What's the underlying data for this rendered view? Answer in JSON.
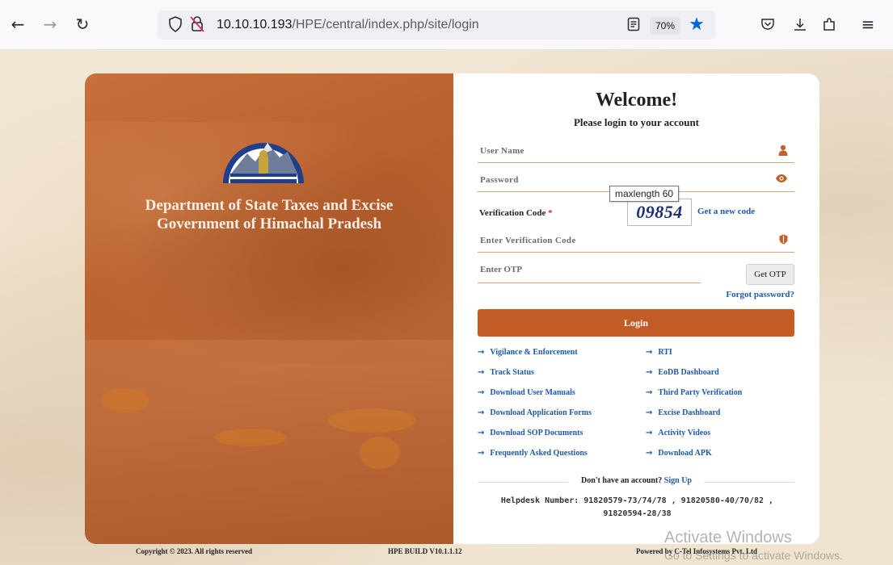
{
  "browser": {
    "url_host": "10.10.10.193",
    "url_path": "/HPE/central/index.php/site/login",
    "zoom": "70%",
    "icons": [
      "back-icon",
      "forward-icon",
      "reload-icon",
      "shield-icon",
      "lock-warning-icon",
      "reader-icon",
      "bookmark-star-icon",
      "pocket-icon",
      "download-icon",
      "extensions-icon",
      "menu-icon"
    ]
  },
  "branding": {
    "dept_line1": "Department of State Taxes and Excise",
    "dept_line2": "Government of Himachal Pradesh"
  },
  "login": {
    "welcome": "Welcome!",
    "subtitle": "Please login to your account",
    "username_placeholder": "User Name",
    "password_placeholder": "Password",
    "verification_label": "Verification Code",
    "required_mark": "*",
    "captcha_text": "09854",
    "tooltip": "maxlength 60",
    "get_new_code": "Get a new code",
    "verification_placeholder": "Enter Verification Code",
    "otp_placeholder": "Enter OTP",
    "get_otp": "Get OTP",
    "forgot_password": "Forgot password?",
    "login_button": "Login"
  },
  "links": {
    "left": [
      "Vigilance & Enforcement",
      "Track Status",
      "Download User Manuals",
      "Download Application Forms",
      "Download SOP Documents",
      "Frequently Asked Questions"
    ],
    "right": [
      "RTI",
      "EoDB Dashboard",
      "Third Party Verification",
      "Excise Dashboard",
      "Activity Videos",
      "Download APK"
    ]
  },
  "signup": {
    "prompt": "Don't have an account?",
    "link": "Sign Up"
  },
  "helpdesk": {
    "line1": "Helpdesk Number: 91820579-73/74/78 , 91820580-40/70/82 ,",
    "line2": "91820594-28/38"
  },
  "footer": {
    "copyright": "Copyright © 2023. All rights reserved",
    "build": "HPE BUILD V10.1.1.12",
    "powered": "Powered by C-Tel Infosystems Pvt. Ltd"
  },
  "watermark": {
    "line1": "Activate Windows",
    "line2": "Go to Settings to activate Windows."
  },
  "colors": {
    "accent": "#c35b26",
    "link": "#1e5aa8"
  }
}
